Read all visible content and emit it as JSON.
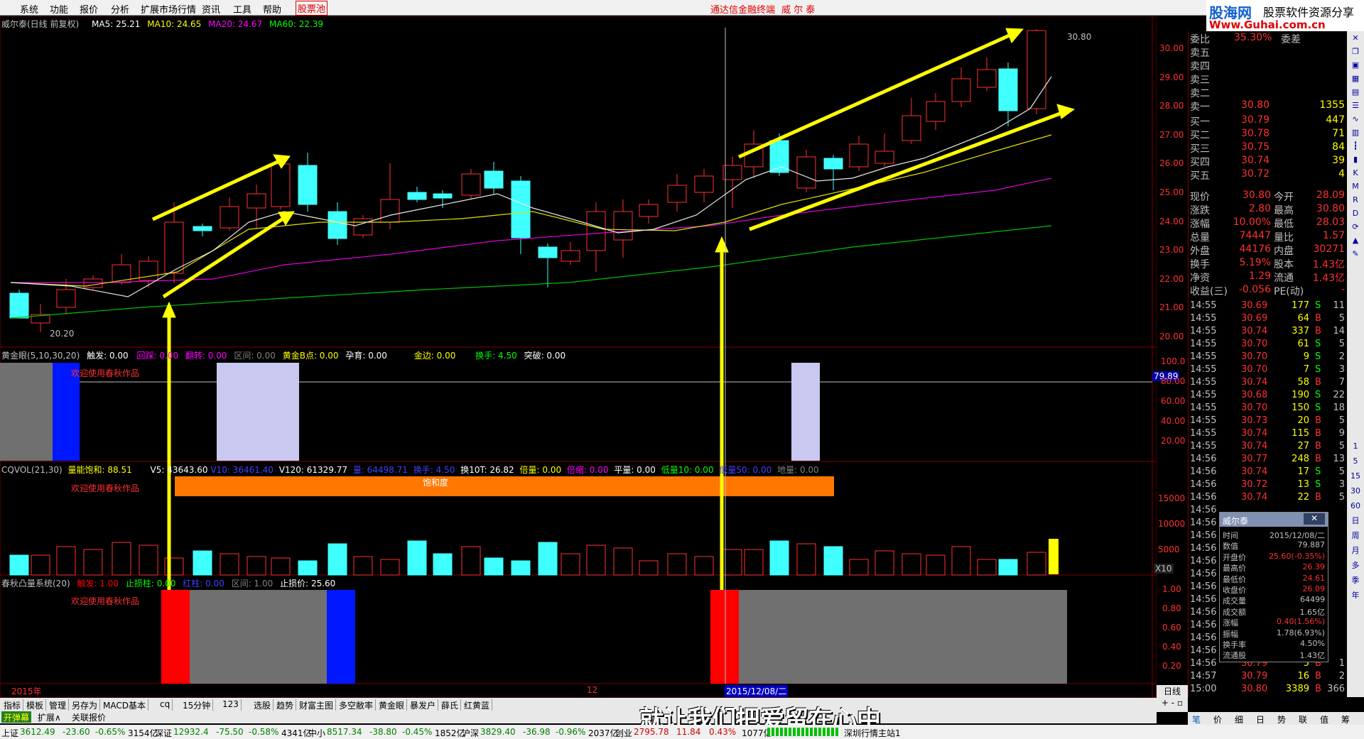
{
  "menu": {
    "items": [
      "系统",
      "功能",
      "报价",
      "分析",
      "扩展市场行情",
      "资讯",
      "工具",
      "帮助",
      "股票池"
    ],
    "app_title": "通达信金融终端",
    "stock_title": "威 尔 泰"
  },
  "logo": {
    "brand": "股海网",
    "tagline": "股票软件资源分享",
    "url": "Www.Guhai.com.cn"
  },
  "main_chart": {
    "stock_label": "威尔泰(日线 前复权)",
    "ma5": "MA5: 25.21",
    "ma10": "MA10: 24.65",
    "ma20": "MA20: 24.67",
    "ma60": "MA60: 22.39",
    "high_marker": "30.80",
    "low_marker": "20.20",
    "price_axis": [
      "30.00",
      "29.00",
      "28.00",
      "27.00",
      "26.00",
      "25.00",
      "24.00",
      "23.00",
      "22.00",
      "21.00",
      "20.00"
    ]
  },
  "indicator1": {
    "name": "黄金眼(5,10,30,20)",
    "items": [
      "触发: 0.00",
      "回踩: 0.00",
      "翻转: 0.00",
      "区间: 0.00",
      "黄金B点: 0.00",
      "孕育: 0.00",
      "金边: 0.00",
      "换手: 4.50",
      "突破: 0.00"
    ],
    "welcome": "欢迎使用春秋作品",
    "axis": [
      "100.0",
      "80.00",
      "60.00",
      "40.00",
      "20.00"
    ],
    "marker": "79.89"
  },
  "indicator2": {
    "name": "CQVOL(21,30)",
    "items": [
      "量能饱和: 88.51",
      "V5: 43643.60",
      "V10: 36461.40",
      "V120: 61329.77",
      "量: 64498.71",
      "换手: 4.50",
      "换10T: 26.82",
      "倍量: 0.00",
      "倍缩: 0.00",
      "平量: 0.00",
      "低量10: 0.00",
      "低量50: 0.00",
      "地量: 0.00"
    ],
    "welcome": "欢迎使用春秋作品",
    "bar_label": "饱和度",
    "axis": [
      "15000",
      "10000",
      "5000"
    ],
    "unit": "X10"
  },
  "indicator3": {
    "name": "春秋凸量系统(20)",
    "items": [
      "触发: 1.00",
      "止损柱: 0.00",
      "红柱: 0.00",
      "区间: 1.00",
      "止损价: 25.60"
    ],
    "welcome": "欢迎使用春秋作品",
    "axis": [
      "1.00",
      "0.80",
      "0.60",
      "0.40",
      "0.20"
    ]
  },
  "date_axis": {
    "year": "2015年",
    "month": "12",
    "selected": "2015/12/08/二",
    "period": "日线"
  },
  "subtitle": "就让我们把爱留在心中",
  "quote_panel": {
    "weibi_label": "委比",
    "weibi_value": "35.30%",
    "weicha_label": "委差",
    "sell": [
      {
        "label": "卖五",
        "price": "",
        "vol": ""
      },
      {
        "label": "卖四",
        "price": "",
        "vol": ""
      },
      {
        "label": "卖三",
        "price": "",
        "vol": ""
      },
      {
        "label": "卖二",
        "price": "",
        "vol": ""
      },
      {
        "label": "卖一",
        "price": "30.80",
        "vol": "1355"
      }
    ],
    "buy": [
      {
        "label": "买一",
        "price": "30.79",
        "vol": "447"
      },
      {
        "label": "买二",
        "price": "30.78",
        "vol": "71"
      },
      {
        "label": "买三",
        "price": "30.75",
        "vol": "84"
      },
      {
        "label": "买四",
        "price": "30.74",
        "vol": "39"
      },
      {
        "label": "买五",
        "price": "30.72",
        "vol": "4"
      }
    ],
    "stats": [
      {
        "l1": "现价",
        "v1": "30.80",
        "l2": "今开",
        "v2": "28.09"
      },
      {
        "l1": "涨跌",
        "v1": "2.80",
        "l2": "最高",
        "v2": "30.80"
      },
      {
        "l1": "涨幅",
        "v1": "10.00%",
        "l2": "最低",
        "v2": "28.03"
      },
      {
        "l1": "总量",
        "v1": "74447",
        "l2": "量比",
        "v2": "1.57"
      },
      {
        "l1": "外盘",
        "v1": "44176",
        "l2": "内盘",
        "v2": "30271"
      },
      {
        "l1": "换手",
        "v1": "5.19%",
        "l2": "股本",
        "v2": "1.43亿"
      },
      {
        "l1": "净资",
        "v1": "1.29",
        "l2": "流通",
        "v2": "1.43亿"
      },
      {
        "l1": "收益(三)",
        "v1": "-0.056",
        "l2": "PE(动)",
        "v2": "-"
      }
    ],
    "ticks": [
      {
        "t": "14:55",
        "p": "30.69",
        "v": "177",
        "s": "S",
        "n": "11"
      },
      {
        "t": "14:55",
        "p": "30.69",
        "v": "64",
        "s": "B",
        "n": "5"
      },
      {
        "t": "14:55",
        "p": "30.74",
        "v": "337",
        "s": "B",
        "n": "14"
      },
      {
        "t": "14:55",
        "p": "30.70",
        "v": "61",
        "s": "S",
        "n": "5"
      },
      {
        "t": "14:55",
        "p": "30.70",
        "v": "9",
        "s": "S",
        "n": "2"
      },
      {
        "t": "14:55",
        "p": "30.70",
        "v": "7",
        "s": "S",
        "n": "3"
      },
      {
        "t": "14:55",
        "p": "30.74",
        "v": "58",
        "s": "B",
        "n": "7"
      },
      {
        "t": "14:55",
        "p": "30.68",
        "v": "190",
        "s": "S",
        "n": "22"
      },
      {
        "t": "14:55",
        "p": "30.70",
        "v": "150",
        "s": "S",
        "n": "18"
      },
      {
        "t": "14:55",
        "p": "30.73",
        "v": "20",
        "s": "B",
        "n": "5"
      },
      {
        "t": "14:55",
        "p": "30.74",
        "v": "115",
        "s": "B",
        "n": "9"
      },
      {
        "t": "14:55",
        "p": "30.74",
        "v": "27",
        "s": "B",
        "n": "5"
      },
      {
        "t": "14:56",
        "p": "30.77",
        "v": "248",
        "s": "B",
        "n": "13"
      },
      {
        "t": "14:56",
        "p": "30.74",
        "v": "17",
        "s": "S",
        "n": "5"
      },
      {
        "t": "14:56",
        "p": "30.72",
        "v": "13",
        "s": "S",
        "n": "3"
      },
      {
        "t": "14:56",
        "p": "30.74",
        "v": "22",
        "s": "B",
        "n": "5"
      },
      {
        "t": "14:56",
        "p": "",
        "v": "",
        "s": "",
        "n": ""
      },
      {
        "t": "14:56",
        "p": "",
        "v": "",
        "s": "",
        "n": ""
      },
      {
        "t": "14:56",
        "p": "",
        "v": "",
        "s": "",
        "n": ""
      },
      {
        "t": "14:56",
        "p": "",
        "v": "",
        "s": "",
        "n": ""
      },
      {
        "t": "14:56",
        "p": "",
        "v": "",
        "s": "",
        "n": ""
      },
      {
        "t": "14:56",
        "p": "",
        "v": "",
        "s": "",
        "n": ""
      },
      {
        "t": "14:56",
        "p": "",
        "v": "",
        "s": "",
        "n": ""
      },
      {
        "t": "14:56",
        "p": "",
        "v": "",
        "s": "",
        "n": ""
      },
      {
        "t": "14:56",
        "p": "",
        "v": "",
        "s": "",
        "n": ""
      },
      {
        "t": "14:56",
        "p": "",
        "v": "",
        "s": "",
        "n": ""
      },
      {
        "t": "14:56",
        "p": "",
        "v": "",
        "s": "",
        "n": ""
      },
      {
        "t": "14:56",
        "p": "",
        "v": "",
        "s": "",
        "n": ""
      },
      {
        "t": "14:56",
        "p": "30.79",
        "v": "5",
        "s": "B",
        "n": "1"
      },
      {
        "t": "14:57",
        "p": "30.79",
        "v": "16",
        "s": "B",
        "n": "2"
      },
      {
        "t": "15:00",
        "p": "30.80",
        "v": "3389",
        "s": "B",
        "n": "366"
      }
    ]
  },
  "popup": {
    "title": "威尔泰",
    "rows": [
      {
        "k": "时间",
        "v": "2015/12/08/二"
      },
      {
        "k": "数值",
        "v": "79.887"
      },
      {
        "k": "开盘价",
        "v": "25.60(-0.35%)"
      },
      {
        "k": "最高价",
        "v": "26.39"
      },
      {
        "k": "最低价",
        "v": "24.61"
      },
      {
        "k": "收盘价",
        "v": "26.09"
      },
      {
        "k": "成交量",
        "v": "64499"
      },
      {
        "k": "成交额",
        "v": "1.65亿"
      },
      {
        "k": "涨幅",
        "v": "0.40(1.56%)"
      },
      {
        "k": "振幅",
        "v": "1.78(6.93%)"
      },
      {
        "k": "换手率",
        "v": "4.50%"
      },
      {
        "k": "流通股",
        "v": "1.43亿"
      }
    ]
  },
  "bottom_tabs": [
    "指标",
    "模板",
    "管理",
    "另存为",
    "MACD基本",
    "cq",
    "15分钟",
    "123",
    "选股",
    "趋势",
    "财富主图",
    "多空敝率",
    "黄金眼",
    "暴发户",
    "薛氏",
    "红黄蓝"
  ],
  "bottom_tabs2": [
    "开弹幕",
    "扩展∧",
    "关联报价"
  ],
  "right_tabs": [
    "笔",
    "价",
    "细",
    "日",
    "势",
    "联",
    "值",
    "筹"
  ],
  "status": [
    {
      "k": "上证",
      "v": "3612.49",
      "c": "-23.60",
      "p": "-0.65%",
      "a": "3154亿"
    },
    {
      "k": "深证",
      "v": "12932.4",
      "c": "-75.50",
      "p": "-0.58%",
      "a": "4341亿"
    },
    {
      "k": "中小",
      "v": "8517.34",
      "c": "-38.80",
      "p": "-0.45%",
      "a": "1852亿"
    },
    {
      "k": "沪深",
      "v": "3829.40",
      "c": "-36.98",
      "p": "-0.96%",
      "a": "2037亿"
    },
    {
      "k": "创业",
      "v": "2795.78",
      "c": "11.84",
      "p": "0.43%",
      "a": "1077亿"
    }
  ],
  "status_right": "深圳行情主站1",
  "toolbar_icons": [
    "close-icon",
    "restore-icon",
    "sq-icon",
    "table-icon",
    "grid-icon",
    "list-icon",
    "line-chart-icon",
    "bar-icon",
    "candle-icon",
    "vol-icon",
    "kdj-icon",
    "macd-icon",
    "rsi-icon",
    "dmi-icon",
    "refresh-icon",
    "up-icon",
    "pen-icon"
  ],
  "toolbar_letters": [
    "1",
    "5",
    "15",
    "30",
    "60",
    "日",
    "周",
    "月",
    "多",
    "季",
    "年"
  ]
}
